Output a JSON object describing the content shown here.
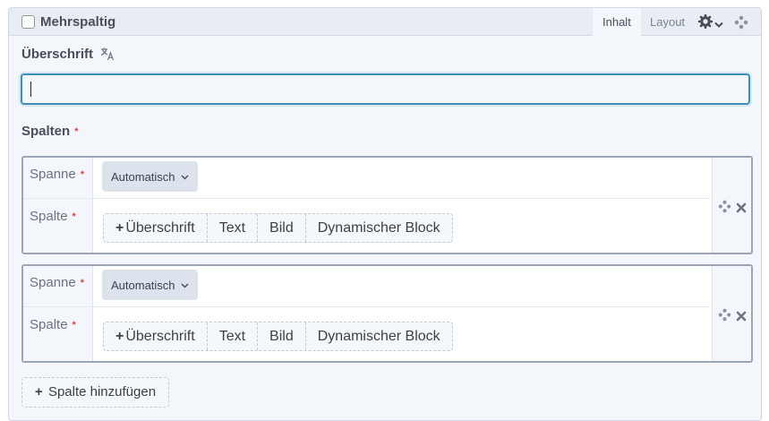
{
  "block": {
    "title": "Mehrspaltig",
    "tabs": [
      {
        "label": "Inhalt",
        "active": true
      },
      {
        "label": "Layout",
        "active": false
      }
    ],
    "icons": [
      "gear-icon",
      "chevron-down-icon",
      "drag-handle-icon"
    ]
  },
  "heading_field": {
    "label": "Überschrift",
    "translate_icon": "translate-icon",
    "value": ""
  },
  "columns_field": {
    "label": "Spalten",
    "required_mark": "*"
  },
  "columns": [
    {
      "span_label": "Spanne",
      "span_value": "Automatisch",
      "column_label": "Spalte",
      "buttons": [
        "Überschrift",
        "Text",
        "Bild",
        "Dynamischer Block"
      ]
    },
    {
      "span_label": "Spanne",
      "span_value": "Automatisch",
      "column_label": "Spalte",
      "buttons": [
        "Überschrift",
        "Text",
        "Bild",
        "Dynamischer Block"
      ]
    }
  ],
  "add_column_label": "Spalte hinzufügen",
  "colors": {
    "accent": "#3f8fb8",
    "required": "#d64545"
  }
}
